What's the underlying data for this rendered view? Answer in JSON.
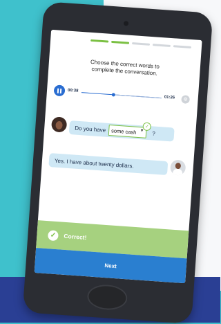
{
  "lesson": {
    "progress_segments": 5,
    "segments_completed": 2,
    "instruction_line1": "Choose the correct words to",
    "instruction_line2": "complete the conversation."
  },
  "audio_player": {
    "current_time": "00:38",
    "total_time": "01:26",
    "progress_fraction": 0.44,
    "play_state_icon": "pause-icon",
    "settings_icon": "gear-icon"
  },
  "conversation": [
    {
      "speaker": "speaker-1",
      "text_before": "Do you have",
      "selected_option": "some cash",
      "text_after": "?"
    },
    {
      "speaker": "speaker-2",
      "text": "Yes. I have about twenty dollars."
    }
  ],
  "feedback": {
    "label": "Correct!",
    "icon": "checkmark-icon",
    "color": "#a6d17f"
  },
  "next_button": {
    "label": "Next",
    "color": "#2a7fd0"
  },
  "colors": {
    "accent_green": "#7bc043",
    "accent_blue": "#2a6dd1",
    "bubble": "#cfe8f5",
    "background_teal": "#3fc1cc",
    "background_navy": "#2a3f94"
  }
}
